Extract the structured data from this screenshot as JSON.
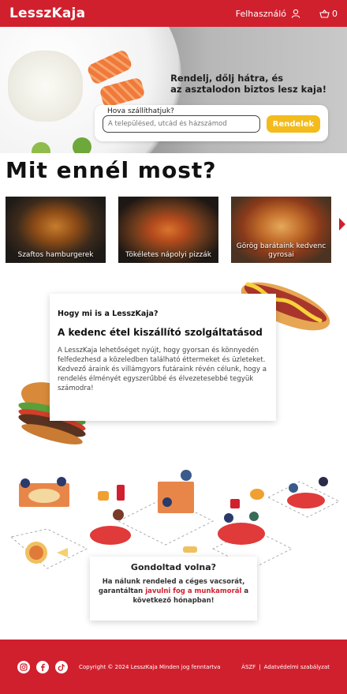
{
  "header": {
    "logo": "LesszKaja",
    "user_label": "Felhasználó",
    "cart_count": "0",
    "brand_color": "#d0202e"
  },
  "hero": {
    "tagline_line1": "Rendelj, dőlj hátra, és",
    "tagline_line2": "az asztalodon biztos lesz kaja!",
    "order_label": "Hova szállíthatjuk?",
    "address_placeholder": "A településed, utcád és házszámod",
    "order_button": "Rendelek",
    "accent_color": "#f3bb1c"
  },
  "section_title": "Mit ennél most?",
  "carousel": {
    "items": [
      {
        "label": "Szaftos hamburgerek"
      },
      {
        "label": "Tökéletes nápolyi pizzák"
      },
      {
        "label": "Görög barátaink kedvenc gyrosai"
      }
    ],
    "next_icon": "chevron-right-icon"
  },
  "about": {
    "eyebrow": "Hogy mi is a LesszKaja?",
    "heading": "A kedenc étel kiszállító szolgáltatásod",
    "body": "A LesszKaja lehetőséget nyújt, hogy gyorsan és könnyedén felfedezhesd a közeledben található éttermeket és üzleteket. Kedvező áraink és villámgyors futáraink révén célunk, hogy a rendelés élményét egyszerűbbé és élvezetesebbé tegyük számodra!"
  },
  "did_you_know": {
    "title": "Gondoltad volna?",
    "body_part1": "Ha nálunk rendeled a céges vacsorát, garantáltan ",
    "body_accent": "javulni fog a munkamorál",
    "body_part2": " a következő hónapban!"
  },
  "footer": {
    "copyright": "Copyright © 2024 LesszKaja Minden jog fenntartva",
    "link1": "ÁSZF",
    "separator": "|",
    "link2": "Adatvédelmi szabályzat",
    "social_icons": [
      "instagram-icon",
      "facebook-icon",
      "tiktok-icon"
    ]
  }
}
